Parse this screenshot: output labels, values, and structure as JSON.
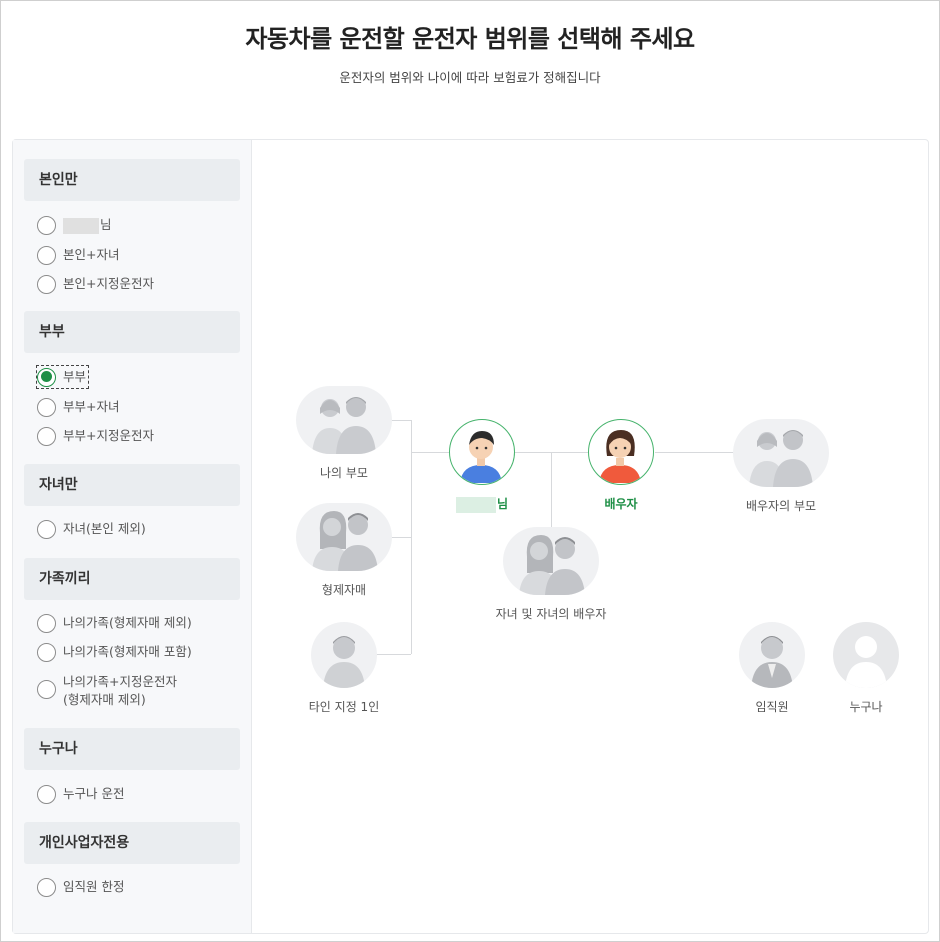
{
  "header": {
    "title": "자동차를 운전할 운전자 범위를 선택해 주세요",
    "subtitle": "운전자의 범위와 나이에 따라 보험료가 정해집니다"
  },
  "sidebar": {
    "groups": [
      {
        "heading": "본인만",
        "options": [
          {
            "label": "님",
            "checked": false,
            "masked_name": true
          },
          {
            "label": "본인+자녀",
            "checked": false
          },
          {
            "label": "본인+지정운전자",
            "checked": false
          }
        ]
      },
      {
        "heading": "부부",
        "options": [
          {
            "label": "부부",
            "checked": true
          },
          {
            "label": "부부+자녀",
            "checked": false
          },
          {
            "label": "부부+지정운전자",
            "checked": false
          }
        ]
      },
      {
        "heading": "자녀만",
        "options": [
          {
            "label": "자녀(본인 제외)",
            "checked": false
          }
        ]
      },
      {
        "heading": "가족끼리",
        "options": [
          {
            "label": "나의가족(형제자매 제외)",
            "checked": false
          },
          {
            "label": "나의가족(형제자매 포함)",
            "checked": false
          },
          {
            "label": "나의가족+지정운전자",
            "label2": "(형제자매 제외)",
            "checked": false
          }
        ]
      },
      {
        "heading": "누구나",
        "options": [
          {
            "label": "누구나 운전",
            "checked": false
          }
        ]
      },
      {
        "heading": "개인사업자전용",
        "options": [
          {
            "label": "임직원 한정",
            "checked": false
          }
        ]
      }
    ]
  },
  "diagram": {
    "my_parents": "나의 부모",
    "siblings": "형제자매",
    "designated": "타인 지정 1인",
    "self_suffix": "님",
    "spouse": "배우자",
    "spouse_parents": "배우자의 부모",
    "children": "자녀 및 자녀의 배우자",
    "employee": "임직원",
    "anyone": "누구나"
  },
  "colors": {
    "accent_green": "#1e8f46",
    "self_shirt": "#4a7fe0",
    "spouse_shirt": "#f05a3c"
  }
}
